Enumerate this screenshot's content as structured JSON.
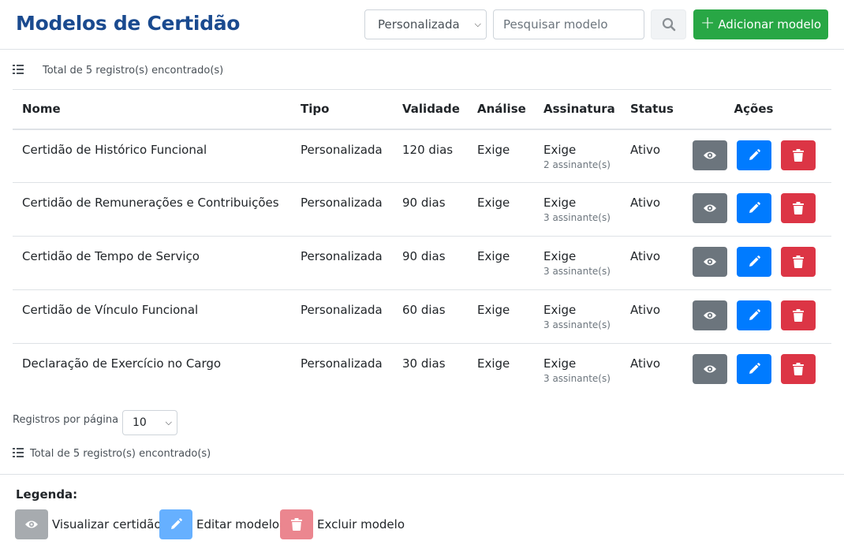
{
  "header": {
    "title": "Modelos de Certidão",
    "type_filter": "Personalizada",
    "search_placeholder": "Pesquisar modelo",
    "add_label": "Adicionar modelo"
  },
  "summary": {
    "total_text": "Total de 5 registro(s) encontrado(s)"
  },
  "table": {
    "headers": [
      "Nome",
      "Tipo",
      "Validade",
      "Análise",
      "Assinatura",
      "Status",
      "Ações"
    ],
    "rows": [
      {
        "nome": "Certidão de Histórico Funcional",
        "tipo": "Personalizada",
        "validade": "120 dias",
        "analise": "Exige",
        "assinatura": "Exige",
        "assinantes": "2 assinante(s)",
        "status": "Ativo"
      },
      {
        "nome": "Certidão de Remunerações e Contribuições",
        "tipo": "Personalizada",
        "validade": "90 dias",
        "analise": "Exige",
        "assinatura": "Exige",
        "assinantes": "3 assinante(s)",
        "status": "Ativo"
      },
      {
        "nome": "Certidão de Tempo de Serviço",
        "tipo": "Personalizada",
        "validade": "90 dias",
        "analise": "Exige",
        "assinatura": "Exige",
        "assinantes": "3 assinante(s)",
        "status": "Ativo"
      },
      {
        "nome": "Certidão de Vínculo Funcional",
        "tipo": "Personalizada",
        "validade": "60 dias",
        "analise": "Exige",
        "assinatura": "Exige",
        "assinantes": "3 assinante(s)",
        "status": "Ativo"
      },
      {
        "nome": "Declaração de Exercício no Cargo",
        "tipo": "Personalizada",
        "validade": "30 dias",
        "analise": "Exige",
        "assinatura": "Exige",
        "assinantes": "3 assinante(s)",
        "status": "Ativo"
      }
    ]
  },
  "pagination": {
    "per_page_label": "Registros por página",
    "per_page_value": "10",
    "total_text": "Total de 5 registro(s) encontrado(s)"
  },
  "legend": {
    "title": "Legenda:",
    "view_label": "Visualizar certidão",
    "edit_label": "Editar modelo",
    "delete_label": "Excluir modelo"
  },
  "colors": {
    "title": "#1a4a8f",
    "add_button": "#28a745",
    "view": "#6c757d",
    "edit": "#007bff",
    "delete": "#dc3545"
  },
  "icons": {
    "view": "eye-icon",
    "edit": "pencil-icon",
    "delete": "trash-icon",
    "search": "search-icon",
    "list": "list-icon",
    "add": "plus-icon"
  }
}
